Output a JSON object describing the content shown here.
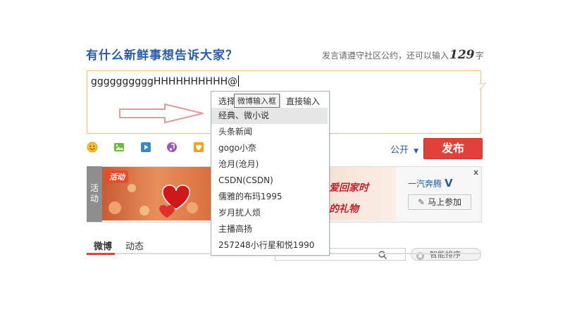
{
  "header": {
    "title": "有什么新鲜事想告诉大家？",
    "hint_prefix": "发言请遵守社区公约，还可以输入",
    "hint_count": "129",
    "hint_suffix": "字"
  },
  "composer": {
    "text": "ggggggggggHHHHHHHHHH@"
  },
  "toolbar": {
    "visibility_label": "公开",
    "publish_label": "发布"
  },
  "mention_dropdown": {
    "hint_start": "选择",
    "hint_end": "直接输入",
    "tooltip": "微博输入框",
    "items": [
      {
        "label": "经典、微小说"
      },
      {
        "label": "头条新闻"
      },
      {
        "label": "gogo小奈"
      },
      {
        "label": "沧月(沧月)"
      },
      {
        "label": "CSDN(CSDN)"
      },
      {
        "label": "儒雅的布玛1995"
      },
      {
        "label": "岁月扰人烦"
      },
      {
        "label": "主播高扬"
      },
      {
        "label": "257248小行星和悦1990"
      }
    ]
  },
  "banner": {
    "tag_line1": "活",
    "tag_line2": "动",
    "badge": "活动",
    "slogan": "爱回家时",
    "slogan2": "的礼物",
    "brand": "一汽奔腾",
    "brand_v": "V",
    "join_label": "马上参加",
    "close": "x"
  },
  "tabs": {
    "weibo": "微博",
    "dynamic": "动态",
    "sort_label": "智能排序"
  },
  "colors": {
    "accent_blue": "#2a5caa",
    "publish_red": "#e2403a",
    "composer_border": "#f0c36d"
  }
}
